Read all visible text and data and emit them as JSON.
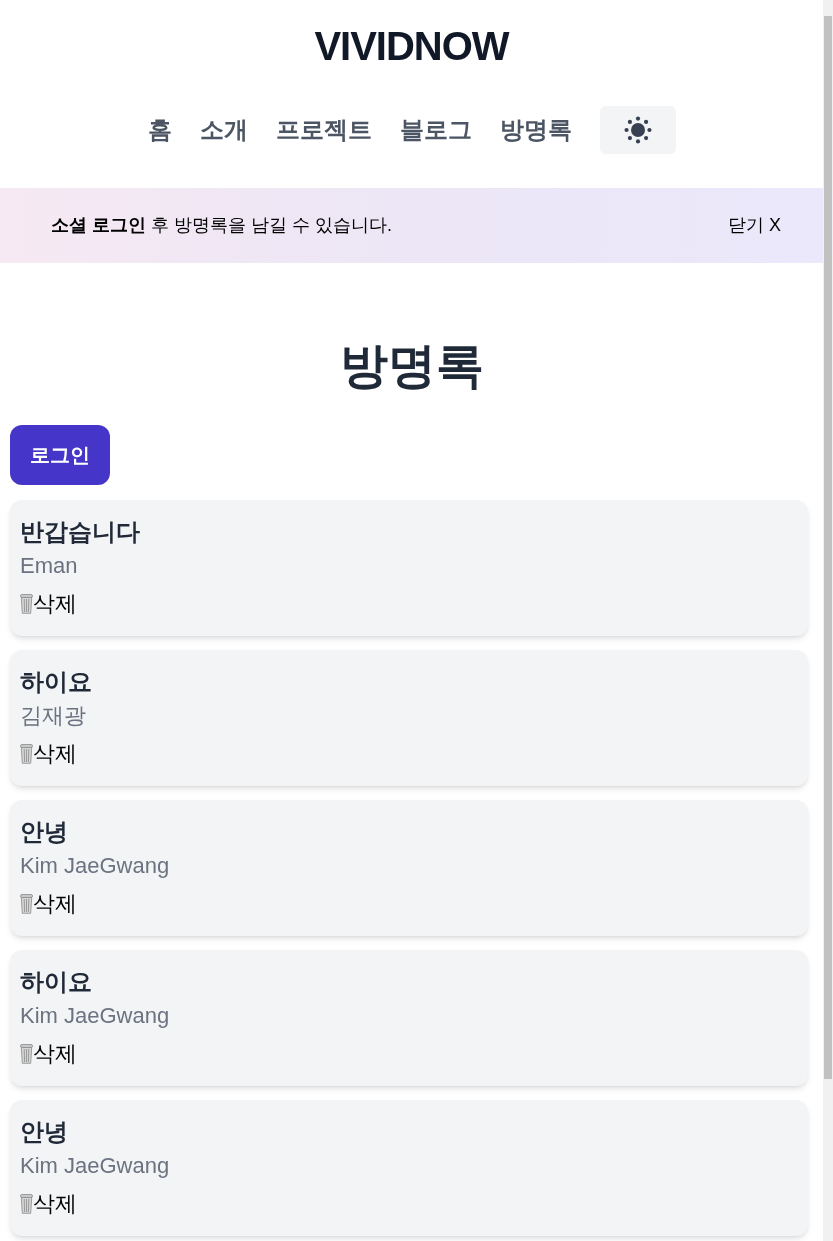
{
  "header": {
    "logo": "VIVIDNOW",
    "nav": [
      {
        "label": "홈"
      },
      {
        "label": "소개"
      },
      {
        "label": "프로젝트"
      },
      {
        "label": "블로그"
      },
      {
        "label": "방명록"
      }
    ]
  },
  "banner": {
    "message": "**소셜 로그인** 후 방명록을 남길 수 있습니다.",
    "close": "닫기 X"
  },
  "page": {
    "title": "방명록",
    "login_button": "로그인"
  },
  "entries": [
    {
      "message": "반갑습니다",
      "author": "Eman",
      "delete": "삭제"
    },
    {
      "message": "하이요",
      "author": "김재광",
      "delete": "삭제"
    },
    {
      "message": "안녕",
      "author": "Kim JaeGwang",
      "delete": "삭제"
    },
    {
      "message": "하이요",
      "author": "Kim JaeGwang",
      "delete": "삭제"
    },
    {
      "message": "안녕",
      "author": "Kim JaeGwang",
      "delete": "삭제"
    }
  ]
}
